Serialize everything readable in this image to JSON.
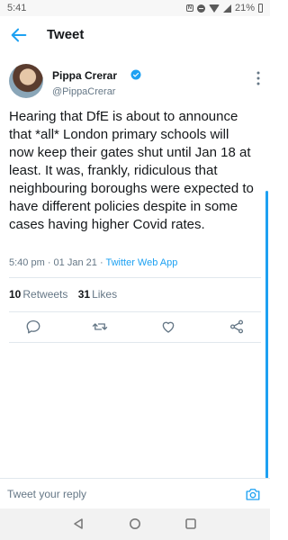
{
  "status_bar": {
    "time": "5:41",
    "battery": "21%"
  },
  "header": {
    "title": "Tweet"
  },
  "tweet": {
    "author_name": "Pippa Crerar",
    "author_handle": "@PippaCrerar",
    "text": "Hearing that DfE is about to announce that *all* London primary schools will now keep their gates shut until Jan 18 at least. It was, frankly, ridiculous that neighbouring boroughs were expected to have different policies despite in some cases having higher Covid rates.",
    "time": "5:40 pm",
    "separator": "·",
    "date": "01 Jan 21",
    "source": "Twitter Web App",
    "retweets_count": "10",
    "retweets_label": "Retweets",
    "likes_count": "31",
    "likes_label": "Likes"
  },
  "reply": {
    "placeholder": "Tweet your reply"
  },
  "colors": {
    "accent": "#1da1f2",
    "text": "#14171a",
    "secondary": "#657786",
    "divider": "#e1e8ed"
  },
  "icons": {
    "back": "arrow-left-icon",
    "verified": "verified-badge-icon",
    "more": "more-vertical-icon",
    "reply": "reply-icon",
    "retweet": "retweet-icon",
    "like": "heart-icon",
    "share": "share-icon",
    "camera": "camera-icon"
  }
}
